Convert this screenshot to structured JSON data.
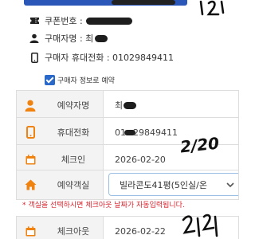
{
  "header": {
    "coupon_label": "쿠폰번호 :",
    "buyer_name_label": "구매자명 : 최",
    "buyer_phone_label": "구매자 휴대전화 : 01029849411"
  },
  "checkbox": {
    "label": "구매자 정보로 예약",
    "checked": true
  },
  "form": {
    "name": {
      "label": "예약자명",
      "value": "최"
    },
    "phone": {
      "label": "휴대전화",
      "value_prefix": "01",
      "value_suffix": "29849411"
    },
    "checkin": {
      "label": "체크인",
      "value": "2026-02-20"
    },
    "room": {
      "label": "예약객실",
      "selected": "빌라콘도41평(5인실/온"
    },
    "checkout": {
      "label": "체크아웃",
      "value": "2026-02-22"
    }
  },
  "notice": "* 객실을 선택하시면 체크아웃 날짜가 자동입력됩니다.",
  "handwriting": {
    "checkin_note": "2/20"
  },
  "colors": {
    "accent": "#f0820f",
    "checkbox": "#2a69c9",
    "notice": "#d9232d",
    "select_border": "#9bbfe3"
  }
}
